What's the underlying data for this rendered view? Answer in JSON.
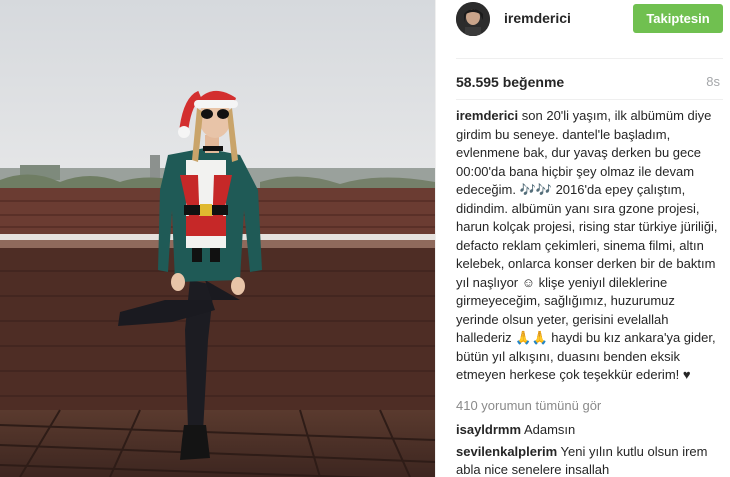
{
  "post": {
    "username": "iremderici",
    "follow_label": "Takiptesin",
    "likes": "58.595 beğenme",
    "time": "8s",
    "caption_user": "iremderici",
    "caption_text": " son 20'li yaşım, ilk albümüm diye girdim bu seneye. dantel'le başladım, evlenmene bak, dur yavaş derken bu gece 00:00'da bana hiçbir şey olmaz ile devam edeceğim. 🎶🎶 2016'da epey çalıştım, didindim. albümün yanı sıra gzone projesi, harun kolçak projesi, rising star türkiye jüriliği, defacto reklam çekimleri, sinema filmi, altın kelebek, onlarca konser derken bir de baktım yıl naşlıyor ☺ klişe yeniyıl dileklerine girmeyeceğim, sağlığımız, huzurumuz yerinde olsun yeter, gerisini evelallah hallederiz 🙏🙏 haydi bu kız ankara'ya gider, bütün yıl alkışını, duasını benden eksik etmeyen herkese çok teşekkür ederim! ♥",
    "view_all_comments": "410 yorumun tümünü gör"
  },
  "comments": [
    {
      "user": "isayldrmm",
      "text": " Adamsın"
    },
    {
      "user": "sevilenkalplerim",
      "text": " Yeni yılın kutlu olsun irem abla nice senelere insallah"
    }
  ],
  "colors": {
    "follow_button": "#70c050",
    "meta_gray": "#a5a7aa"
  },
  "icons": {
    "avatar": "profile-photo"
  }
}
